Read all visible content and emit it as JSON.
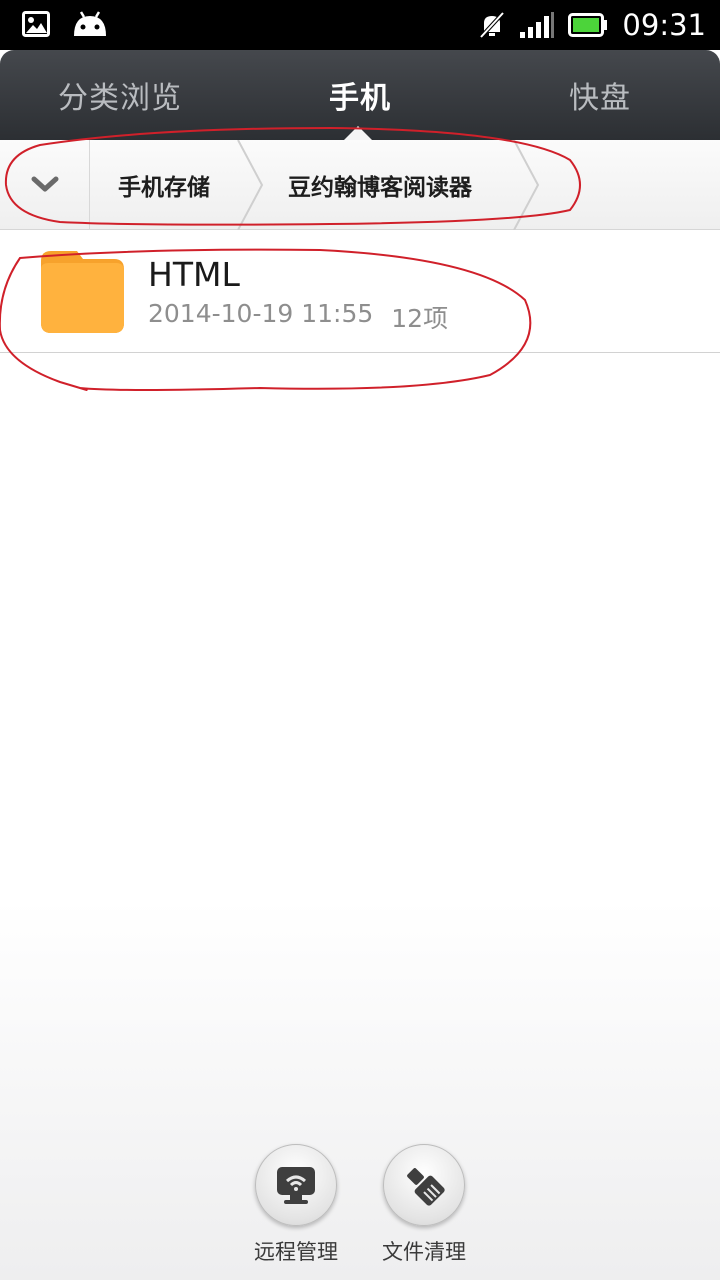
{
  "status_bar": {
    "time": "09:31",
    "icons": [
      "picture-icon",
      "android-icon",
      "mute-icon",
      "signal-icon",
      "battery-icon"
    ]
  },
  "tabs": [
    {
      "label": "分类浏览",
      "active": false
    },
    {
      "label": "手机",
      "active": true
    },
    {
      "label": "快盘",
      "active": false
    }
  ],
  "breadcrumb": {
    "items": [
      "手机存储",
      "豆约翰博客阅读器"
    ]
  },
  "files": [
    {
      "name": "HTML",
      "date": "2014-10-19 11:55",
      "count": "12项",
      "icon": "folder-icon"
    }
  ],
  "actions": [
    {
      "label": "远程管理",
      "icon": "remote-manage-icon"
    },
    {
      "label": "文件清理",
      "icon": "file-clean-icon"
    }
  ],
  "colors": {
    "tab_bar": "#35383c",
    "folder": "#ffb03a",
    "annotation": "#d0202a",
    "battery": "#4cd43a"
  }
}
